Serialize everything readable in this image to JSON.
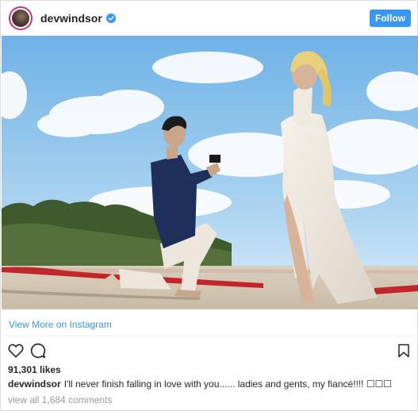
{
  "post": {
    "username": "devwindsor",
    "verified": true,
    "follow_label": "Follow",
    "photo_description_icon": "proposal-photo",
    "view_more_label": "View More on Instagram",
    "likes": "91,301 likes",
    "caption_user": "devwindsor",
    "caption_text": "I'll never finish falling in love with you...... ladies and gents, my fiancé!!!! ☐☐☐",
    "view_all_comments": "view all 1,684 comments"
  },
  "icons": {
    "avatar": "avatar",
    "verified": "verified-badge-icon",
    "like": "heart-icon",
    "comment": "comment-bubble-icon",
    "save": "bookmark-icon"
  },
  "colors": {
    "accent": "#3897f0",
    "text": "#262626",
    "muted": "#999999",
    "border": "#dbdbdb"
  }
}
